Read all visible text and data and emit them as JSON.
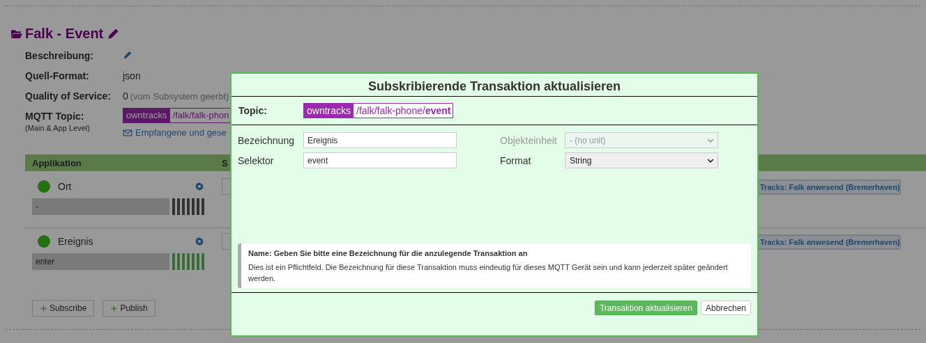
{
  "header": {
    "title": "Falk - Event"
  },
  "details": [
    {
      "kind": "edit",
      "label": "Beschreibung:"
    },
    {
      "kind": "text",
      "label": "Quell-Format:",
      "value": "json"
    },
    {
      "kind": "qos",
      "label": "Quality of Service:",
      "value": "0",
      "note": "(vom Subsystem geerbt)"
    },
    {
      "kind": "topic",
      "label": "MQTT Topic:",
      "sublabel": "(Main & App Level)",
      "prefix": "owntracks",
      "path": "/falk/falk-phon",
      "link": "Empfangene und gese"
    }
  ],
  "table": {
    "columns": [
      "Applikation",
      "S"
    ],
    "rows": [
      {
        "name": "Ort",
        "value": "-",
        "active": false,
        "action": "Tracks: Falk anwesend (Bremerhaven)"
      },
      {
        "name": "Ereignis",
        "value": "enter",
        "active": true,
        "action": "Tracks: Falk anwesend (Bremerhaven)"
      }
    ]
  },
  "actions": [
    "Subscribe",
    "Publish"
  ],
  "dialog": {
    "title": "Subskribierende Transaktion aktualisieren",
    "topic": {
      "label": "Topic:",
      "prefix": "owntracks",
      "path": "/falk/falk-phone/**event**"
    },
    "fields": [
      {
        "kind": "input",
        "label": "Bezeichnung",
        "value": "Ereignis",
        "disabled": false
      },
      {
        "kind": "select",
        "label": "Objekteinheit",
        "value": "- (no unit)",
        "disabled": true
      },
      {
        "kind": "input",
        "label": "Selektor",
        "value": "event",
        "disabled": false
      },
      {
        "kind": "select",
        "label": "Format",
        "value": "String",
        "disabled": false
      }
    ],
    "help": {
      "title": "Name: Geben Sie bitte eine Bezeichnung für die anzulegende Transaktion an",
      "text": "Dies ist ein Pflichtfeld. Die Bezeichnung für diese Transaktion muss eindeutig für dieses MQTT Gerät sein und kann jederzeit später geändert werden."
    },
    "buttons": [
      {
        "kind": "primary",
        "label": "Transaktion aktualisieren"
      },
      {
        "kind": "default",
        "label": "Abbrechen"
      }
    ]
  }
}
